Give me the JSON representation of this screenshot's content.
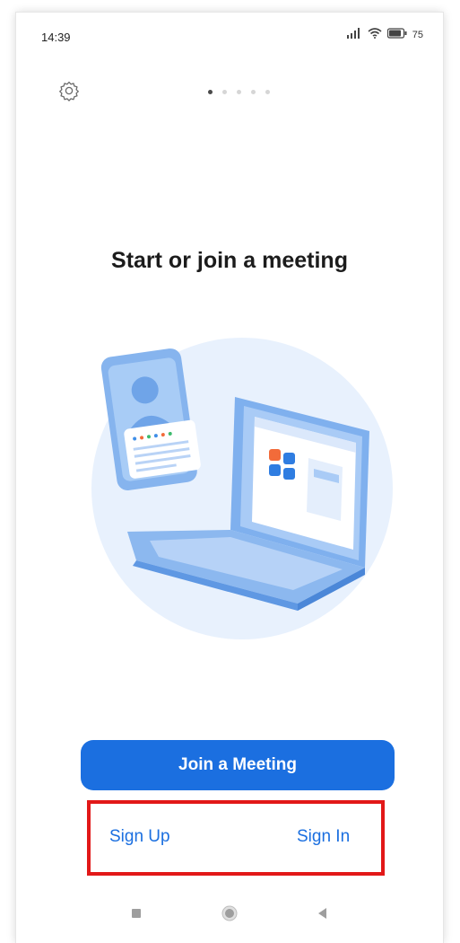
{
  "status_bar": {
    "time": "14:39",
    "battery_text": "75",
    "icons": [
      "signal-icon",
      "wifi-icon",
      "battery-icon"
    ]
  },
  "header": {
    "settings_icon": "gear-icon",
    "page_indicator": {
      "count": 5,
      "active_index": 0
    }
  },
  "main": {
    "title": "Start or join a meeting",
    "illustration": "meeting-illustration"
  },
  "actions": {
    "join_label": "Join a Meeting",
    "sign_up_label": "Sign Up",
    "sign_in_label": "Sign In"
  },
  "nav_bar": {
    "items": [
      "recent-apps-icon",
      "home-icon",
      "back-icon"
    ]
  },
  "colors": {
    "accent": "#1b6fe0",
    "highlight": "#e21818",
    "illustration_bg": "#e8f1fd"
  }
}
